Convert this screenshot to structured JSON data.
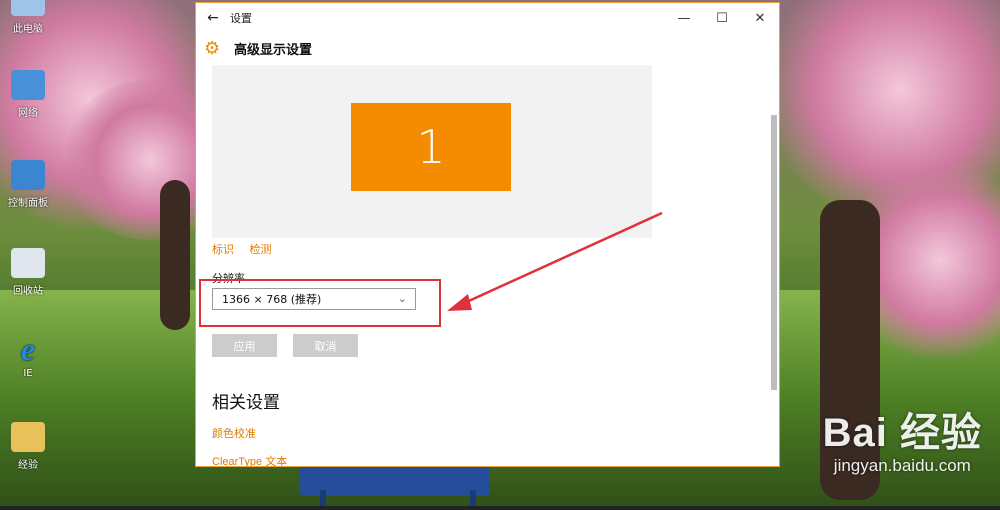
{
  "desktop": {
    "icons": [
      {
        "label": "此电脑",
        "icon": "this-pc-icon"
      },
      {
        "label": "网络",
        "icon": "network-icon"
      },
      {
        "label": "控制面板",
        "icon": "control-panel-icon"
      },
      {
        "label": "回收站",
        "icon": "recycle-bin-icon"
      },
      {
        "label": "IE",
        "icon": "internet-explorer-icon"
      },
      {
        "label": "经验",
        "icon": "folder-icon"
      }
    ],
    "watermark_brand": "Bai 经验",
    "watermark_url": "jingyan.baidu.com"
  },
  "window": {
    "app_title": "设置",
    "back_icon": "back-arrow-icon",
    "header_icon": "gear-icon",
    "page_title": "高级显示设置",
    "monitor_number": "1",
    "identify_link": "标识",
    "detect_link": "检测",
    "resolution_label": "分辨率",
    "resolution_value": "1366 × 768 (推荐)",
    "apply_label": "应用",
    "cancel_label": "取消",
    "related_heading": "相关设置",
    "color_calibration_link": "颜色校准",
    "cleartype_link": "ClearType 文本"
  },
  "colors": {
    "accent": "#f08c00",
    "monitor": "#f58b00",
    "annotation": "#e0303a",
    "window_border": "#e8a23a"
  }
}
